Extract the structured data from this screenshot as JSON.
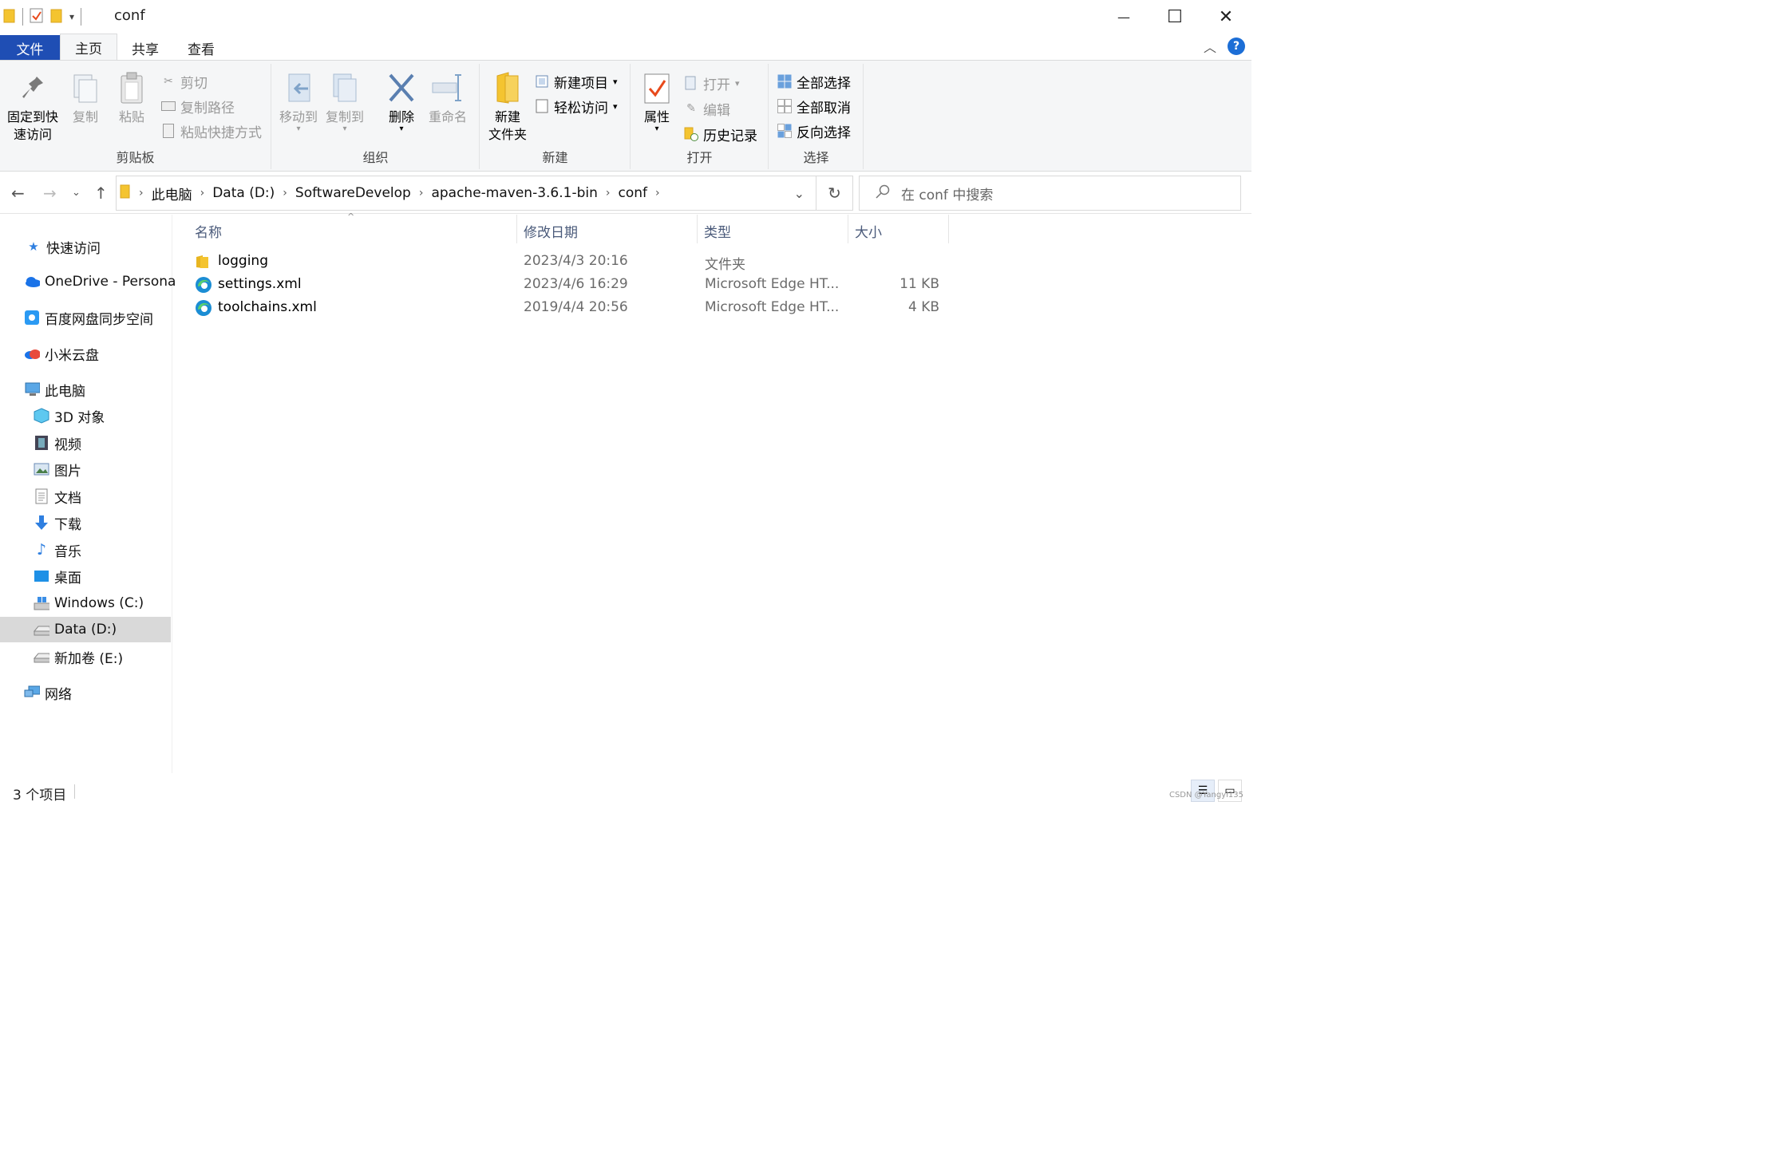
{
  "window": {
    "title": "conf",
    "qat_dropdown": "▾",
    "minimize": "—",
    "maximize": "☐",
    "close": "✕"
  },
  "tabs": [
    {
      "label": "文件"
    },
    {
      "label": "主页"
    },
    {
      "label": "共享"
    },
    {
      "label": "查看"
    }
  ],
  "ribbon": {
    "clipboard": {
      "group_label": "剪贴板",
      "pin_label_1": "固定到快",
      "pin_label_2": "速访问",
      "copy": "复制",
      "paste": "粘贴",
      "cut": "剪切",
      "copy_path": "复制路径",
      "paste_shortcut": "粘贴快捷方式"
    },
    "organize": {
      "group_label": "组织",
      "move_to": "移动到",
      "copy_to": "复制到",
      "delete": "删除",
      "rename": "重命名"
    },
    "new": {
      "group_label": "新建",
      "new_folder_1": "新建",
      "new_folder_2": "文件夹",
      "new_item": "新建项目",
      "easy_access": "轻松访问"
    },
    "open": {
      "group_label": "打开",
      "properties": "属性",
      "open": "打开",
      "edit": "编辑",
      "history": "历史记录"
    },
    "select": {
      "group_label": "选择",
      "select_all": "全部选择",
      "select_none": "全部取消",
      "invert": "反向选择"
    }
  },
  "address": {
    "breadcrumbs": [
      "此电脑",
      "Data (D:)",
      "SoftwareDevelop",
      "apache-maven-3.6.1-bin",
      "conf"
    ],
    "search_placeholder": "在 conf 中搜索"
  },
  "nav": {
    "quick_access": "快速访问",
    "onedrive": "OneDrive - Persona",
    "baidu": "百度网盘同步空间",
    "xiaomi": "小米云盘",
    "this_pc": "此电脑",
    "objects3d": "3D 对象",
    "videos": "视频",
    "pictures": "图片",
    "documents": "文档",
    "downloads": "下载",
    "music": "音乐",
    "desktop": "桌面",
    "drive_c": "Windows (C:)",
    "drive_d": "Data (D:)",
    "drive_e": "新加卷 (E:)",
    "network": "网络"
  },
  "columns": {
    "name": "名称",
    "modified": "修改日期",
    "type": "类型",
    "size": "大小"
  },
  "files": [
    {
      "name": "logging",
      "modified": "2023/4/3 20:16",
      "type": "文件夹",
      "size": "",
      "icon": "folder-icon"
    },
    {
      "name": "settings.xml",
      "modified": "2023/4/6 16:29",
      "type": "Microsoft Edge HT...",
      "size": "11 KB",
      "icon": "edge-icon"
    },
    {
      "name": "toolchains.xml",
      "modified": "2019/4/4 20:56",
      "type": "Microsoft Edge HT...",
      "size": "4 KB",
      "icon": "edge-icon"
    }
  ],
  "status": {
    "item_count": "3 个项目",
    "watermark": "CSDN @Yangyi135"
  },
  "colors": {
    "file_tab": "#1f4eb4",
    "ribbon_bg": "#f5f6f7",
    "selection": "#d9d9d9",
    "folder": "#f4c430"
  }
}
